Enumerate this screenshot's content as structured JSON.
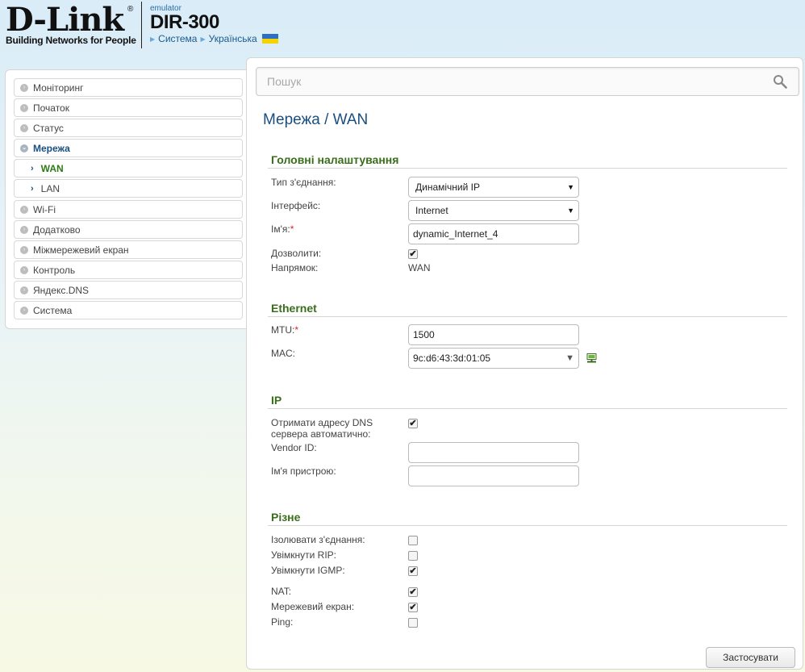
{
  "header": {
    "logo_text": "D-Link",
    "logo_tagline": "Building Networks for People",
    "emulator_label": "emulator",
    "model": "DIR-300",
    "breadcrumb": [
      "Система",
      "Українська"
    ]
  },
  "sidebar": {
    "items": [
      {
        "label": "Моніторинг"
      },
      {
        "label": "Початок"
      },
      {
        "label": "Статус"
      },
      {
        "label": "Мережа"
      },
      {
        "label": "WAN"
      },
      {
        "label": "LAN"
      },
      {
        "label": "Wi-Fi"
      },
      {
        "label": "Додатково"
      },
      {
        "label": "Міжмережевий екран"
      },
      {
        "label": "Контроль"
      },
      {
        "label": "Яндекс.DNS"
      },
      {
        "label": "Система"
      }
    ]
  },
  "search": {
    "placeholder": "Пошук"
  },
  "page": {
    "title": "Мережа /  WAN",
    "sections": {
      "main": "Головні налаштування",
      "ethernet": "Ethernet",
      "ip": "IP",
      "misc": "Різне"
    },
    "fields": {
      "conn_type_label": "Тип з'єднання:",
      "conn_type_value": "Динамічний IP",
      "interface_label": "Інтерфейс:",
      "interface_value": "Internet",
      "name_label": "Ім'я:",
      "name_value": "dynamic_Internet_4",
      "enable_label": "Дозволити:",
      "direction_label": "Напрямок:",
      "direction_value": "WAN",
      "mtu_label": "MTU:",
      "mtu_value": "1500",
      "mac_label": "MAC:",
      "mac_value": "9c:d6:43:3d:01:05",
      "dns_auto_label_1": "Отримати адресу DNS",
      "dns_auto_label_2": "сервера автоматично:",
      "vendor_label": "Vendor ID:",
      "vendor_value": "",
      "device_name_label": "Ім'я пристрою:",
      "device_name_value": "",
      "isolate_label": "Ізолювати з'єднання:",
      "rip_label": "Увімкнути RIP:",
      "igmp_label": "Увімкнути IGMP:",
      "nat_label": "NAT:",
      "firewall_label": "Мережевий екран:",
      "ping_label": "Ping:"
    },
    "checkboxes": {
      "enable": true,
      "dns_auto": true,
      "isolate": false,
      "rip": false,
      "igmp": true,
      "nat": true,
      "firewall": true,
      "ping": false
    },
    "required_mark": "*",
    "check_glyph": "✔",
    "apply_label": "Застосувати"
  },
  "colors": {
    "accent_blue": "#1a4e80",
    "section_green": "#3a6e1c",
    "selected_green": "#2e7a17",
    "required_red": "#dd2222"
  }
}
